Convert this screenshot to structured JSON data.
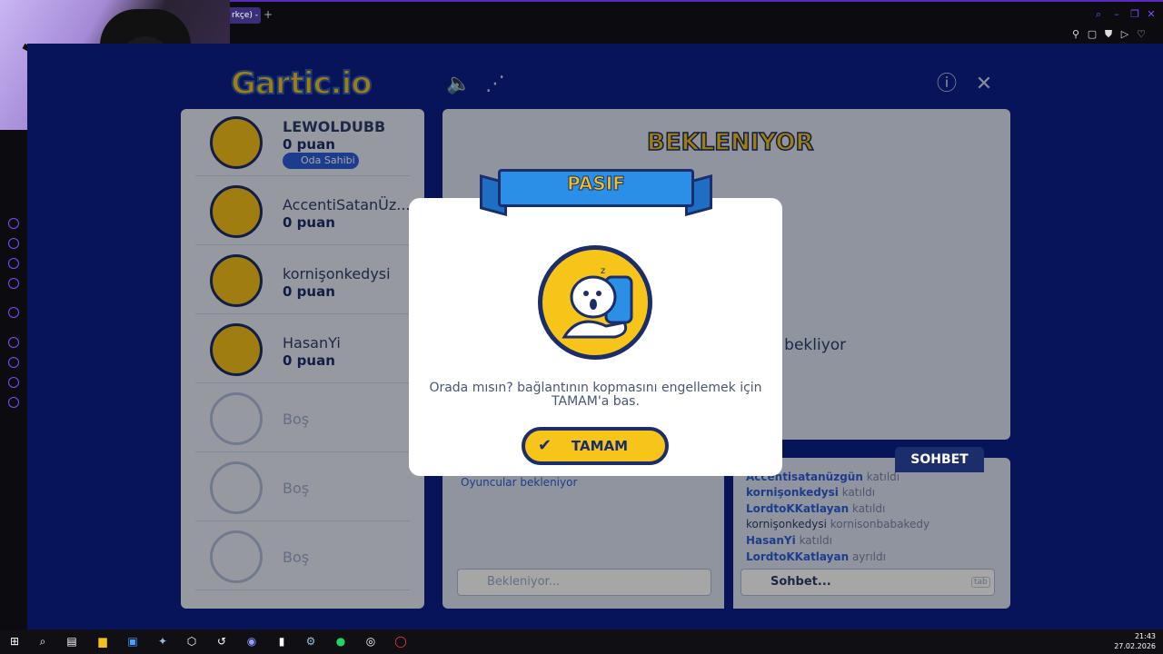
{
  "browser": {
    "tab_label": "rkçe) - ",
    "new_tab": "+"
  },
  "game": {
    "logo": "Gartic.io",
    "board_title": "BEKLENIYOR",
    "board_waiting": "n bekliyor",
    "players": [
      {
        "name": "LEWOLDUBB",
        "points": "0 puan",
        "badge": "Oda Sahibi"
      },
      {
        "name": "AccentiSatanÜz...",
        "points": "0 puan"
      },
      {
        "name": "kornişonkedysi",
        "points": "0 puan"
      },
      {
        "name": "HasanYi",
        "points": "0 puan"
      }
    ],
    "empty_slots": [
      "Boş",
      "Boş",
      "Boş"
    ],
    "answers_info": "Oyuncular bekleniyor",
    "answers_placeholder": "Bekleniyor...",
    "chat_tab": "SOHBET",
    "chat_placeholder": "Sohbet...",
    "chat_shortcut": "tab",
    "chat_log": [
      {
        "user": "Accentisatanüzgün",
        "action": "katıldı"
      },
      {
        "user": "kornişonkedysi",
        "action": "katıldı"
      },
      {
        "user": "LordtoKKatlayan",
        "action": "katıldı"
      },
      {
        "user": "kornişonkedysi",
        "message": "kornisonbabakedy"
      },
      {
        "user": "HasanYi",
        "action": "katıldı"
      },
      {
        "user": "LordtoKKatlayan",
        "action": "ayrıldı"
      }
    ]
  },
  "modal": {
    "title": "PASIF",
    "message": "Orada mısın? bağlantının kopmasını engellemek için TAMAM'a bas.",
    "ok_label": "TAMAM"
  },
  "taskbar": {
    "time": "21:43",
    "date": "27.02.2026"
  }
}
